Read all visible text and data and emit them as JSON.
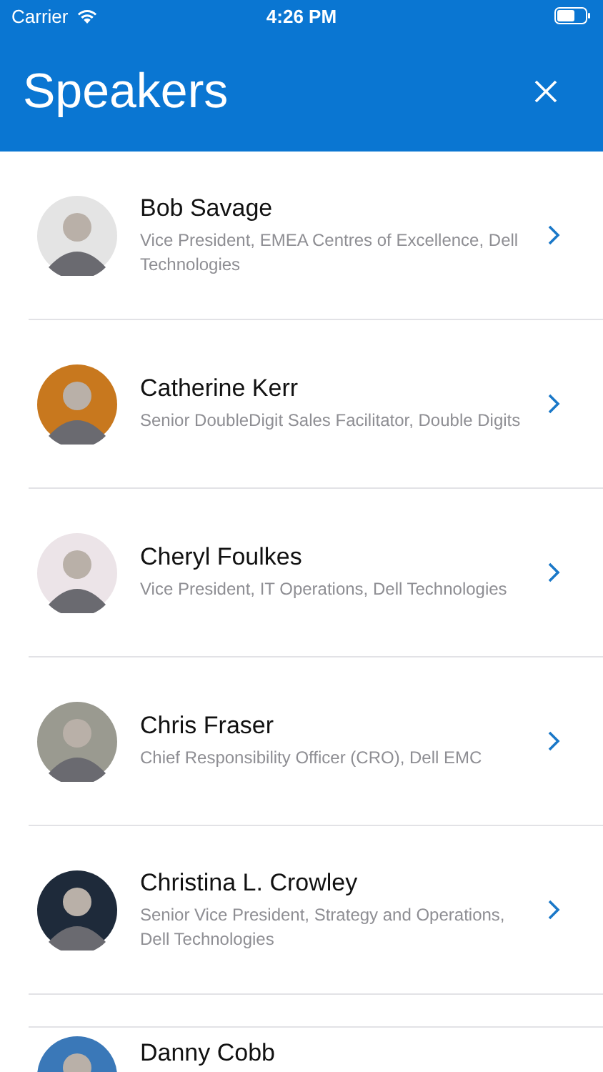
{
  "status_bar": {
    "carrier": "Carrier",
    "time": "4:26 PM"
  },
  "header": {
    "title": "Speakers"
  },
  "speakers": [
    {
      "name": "Bob Savage",
      "title": "Vice President, EMEA Centres of Excellence, Dell Technologies"
    },
    {
      "name": "Catherine Kerr",
      "title": "Senior DoubleDigit Sales Facilitator, Double Digits"
    },
    {
      "name": "Cheryl Foulkes",
      "title": "Vice President, IT Operations, Dell Technologies"
    },
    {
      "name": "Chris Fraser",
      "title": "Chief Responsibility Officer (CRO), Dell EMC"
    },
    {
      "name": "Christina L. Crowley",
      "title": "Senior Vice President, Strategy and Operations, Dell Technologies"
    }
  ],
  "next_section": [
    {
      "name": "Danny Cobb"
    }
  ]
}
